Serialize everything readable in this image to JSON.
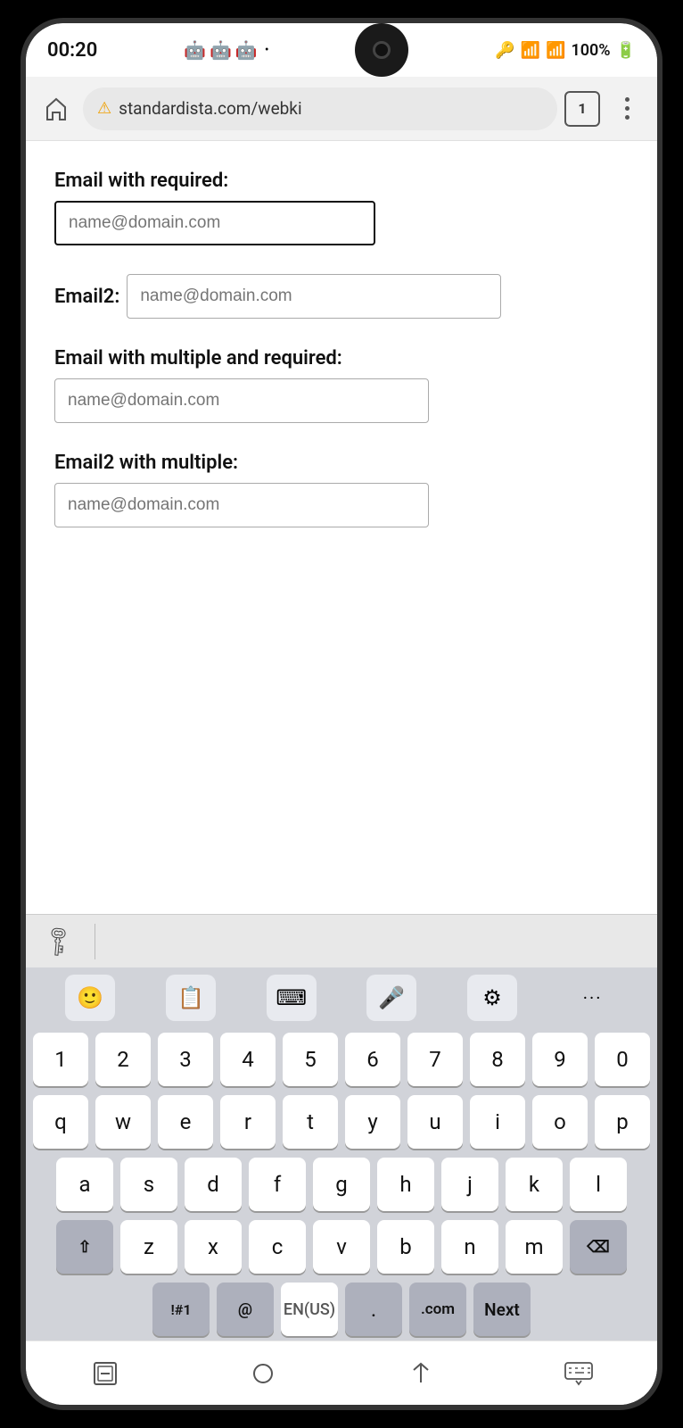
{
  "status": {
    "time": "00:20",
    "battery": "100%",
    "tab_count": "1"
  },
  "browser": {
    "url": "standardista.com/webki",
    "tab_count": "1"
  },
  "form": {
    "field1_label": "Email with required:",
    "field1_placeholder": "name@domain.com",
    "field2_label": "Email2:",
    "field2_placeholder": "name@domain.com",
    "field3_label": "Email with multiple and required:",
    "field3_placeholder": "name@domain.com",
    "field4_label": "Email2 with multiple:",
    "field4_placeholder": "name@domain.com"
  },
  "keyboard": {
    "row_numbers": [
      "1",
      "2",
      "3",
      "4",
      "5",
      "6",
      "7",
      "8",
      "9",
      "0"
    ],
    "row1": [
      "q",
      "w",
      "e",
      "r",
      "t",
      "y",
      "u",
      "i",
      "o",
      "p"
    ],
    "row2": [
      "a",
      "s",
      "d",
      "f",
      "g",
      "h",
      "j",
      "k",
      "l"
    ],
    "row3": [
      "z",
      "x",
      "c",
      "v",
      "b",
      "n",
      "m"
    ],
    "special_left": "!#1",
    "at": "@",
    "space": "EN(US)",
    "dot": ".",
    "dotcom": ".com",
    "next": "Next"
  },
  "toolbar_icons": {
    "emoji": "🙂",
    "clipboard": "📋",
    "keyboard": "⌨",
    "mic": "🎤",
    "settings": "⚙",
    "more": "···"
  }
}
